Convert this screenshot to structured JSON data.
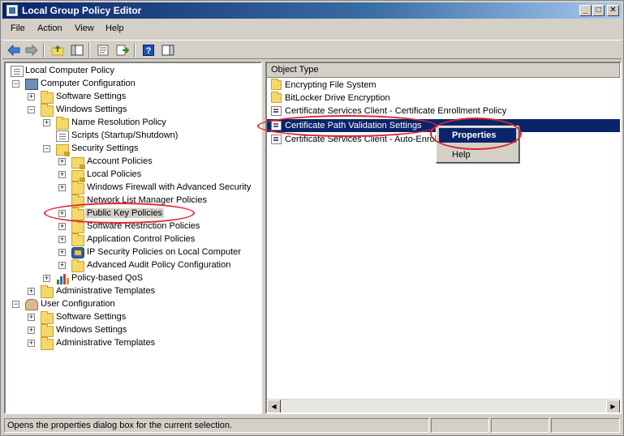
{
  "window": {
    "title": "Local Group Policy Editor",
    "minimize": "_",
    "maximize": "□",
    "close": "✕"
  },
  "menu": {
    "items": [
      "File",
      "Action",
      "View",
      "Help"
    ]
  },
  "toolbar": {
    "icons": [
      "back-arrow-icon",
      "forward-arrow-icon",
      "up-folder-icon",
      "show-hide-tree-icon",
      "properties-icon",
      "export-list-icon",
      "help-icon"
    ],
    "help_glyph": "?"
  },
  "tree": {
    "root": "Local Computer Policy",
    "computer_configuration": "Computer Configuration",
    "cc_software_settings": "Software Settings",
    "cc_windows_settings": "Windows Settings",
    "name_resolution_policy": "Name Resolution Policy",
    "scripts": "Scripts (Startup/Shutdown)",
    "security_settings": "Security Settings",
    "account_policies": "Account Policies",
    "local_policies": "Local Policies",
    "windows_firewall": "Windows Firewall with Advanced Security",
    "network_list_manager": "Network List Manager Policies",
    "public_key_policies": "Public Key Policies",
    "software_restriction": "Software Restriction Policies",
    "application_control": "Application Control Policies",
    "ip_security": "IP Security Policies on Local Computer",
    "advanced_audit": "Advanced Audit Policy Configuration",
    "policy_based_qos": "Policy-based QoS",
    "cc_admin_templates": "Administrative Templates",
    "user_configuration": "User Configuration",
    "uc_software_settings": "Software Settings",
    "uc_windows_settings": "Windows Settings",
    "uc_admin_templates": "Administrative Templates",
    "expand": "+",
    "collapse": "−"
  },
  "list": {
    "column_header": "Object Type",
    "rows": [
      "Encrypting File System",
      "BitLocker Drive Encryption",
      "Certificate Services Client - Certificate Enrollment Policy",
      "Certificate Path Validation Settings",
      "Certificate Services Client - Auto-Enrollment"
    ],
    "scroll_left": "◀",
    "scroll_right": "▶"
  },
  "context_menu": {
    "properties": "Properties",
    "help": "Help"
  },
  "status": {
    "text": "Opens the properties dialog box for the current selection."
  },
  "colors": {
    "selection": "#0a246a",
    "annotation": "#e0262e",
    "chrome": "#d4d0c8"
  }
}
